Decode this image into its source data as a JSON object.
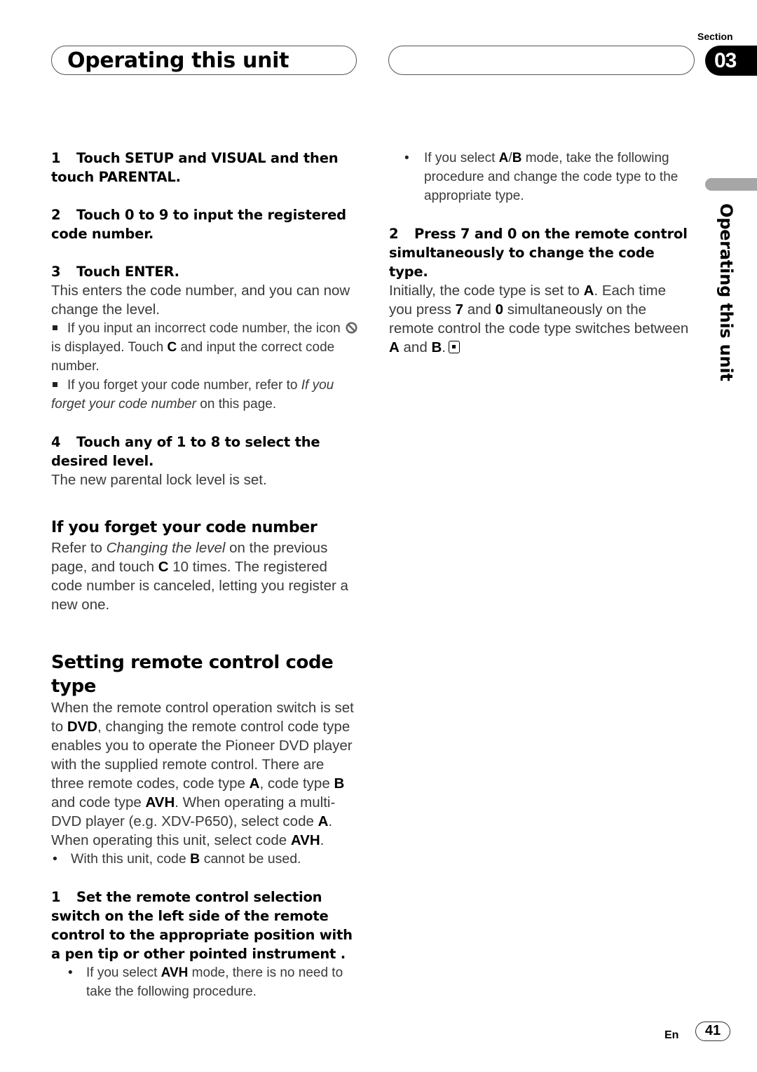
{
  "header": {
    "title": "Operating this unit",
    "section_label": "Section",
    "section_number": "03"
  },
  "side_tab": {
    "label": "Operating this unit"
  },
  "left_column": {
    "step1": {
      "num": "1",
      "text": "Touch SETUP and VISUAL and then touch PARENTAL."
    },
    "step2": {
      "num": "2",
      "text": "Touch 0 to 9 to input the registered code number."
    },
    "step3": {
      "num": "3",
      "text": "Touch ENTER."
    },
    "step3_body": "This enters the code number, and you can now change the level.",
    "note1": {
      "part1": "If you input an incorrect code number, the icon",
      "icon": "prohibited-icon",
      "part2": "is displayed. Touch",
      "key": "C",
      "part3": "and input the correct code number."
    },
    "note2": {
      "part1": "If you forget your code number, refer to",
      "italic": "If you forget your code number",
      "part2": "on this page."
    },
    "step4": {
      "num": "4",
      "text": "Touch any of 1 to 8 to select the desired level."
    },
    "step4_body": "The new parental lock level is set.",
    "forget_heading": "If you forget your code number",
    "forget_body": {
      "part1": "Refer to",
      "italic": "Changing the level",
      "part2": "on the previous page, and touch",
      "key": "C",
      "part3": "10 times. The registered code number is canceled, letting you register a new one."
    },
    "remote_heading": "Setting remote control code type",
    "remote_body": {
      "p1": "When the remote control operation switch is set to",
      "k1": "DVD",
      "p2": ", changing the remote control code type enables you to operate the Pioneer DVD player with the supplied remote control. There are three remote codes, code type",
      "k2": "A",
      "p3": ", code type",
      "k3": "B",
      "p4": "and code type",
      "k4": "AVH",
      "p5": ". When operating a multi-DVD player (e.g. XDV-P650), select code",
      "k5": "A",
      "p6": ". When operating this unit, select code",
      "k6": "AVH",
      "p7": "."
    },
    "remote_bullet": {
      "p1": "With this unit, code",
      "k1": "B",
      "p2": "cannot be used."
    },
    "rstep1": {
      "num": "1",
      "text": "Set the remote control selection switch on the left side of the remote control to the appropriate position with a pen tip or other pointed instrument ."
    },
    "rstep1_bullet": {
      "p1": "If you select",
      "k1": "AVH",
      "p2": "mode, there is no need to take the following procedure."
    }
  },
  "right_column": {
    "bullet": {
      "p1": "If you select",
      "k1": "A",
      "sep": "/",
      "k2": "B",
      "p2": "mode, take the following procedure and change the code type to the appropriate type."
    },
    "step2": {
      "num": "2",
      "text": "Press 7 and 0 on the remote control simultaneously to change the code type."
    },
    "step2_body": {
      "p1": "Initially, the code type is set to",
      "k1": "A",
      "p2": ". Each time you press",
      "k2": "7",
      "p3": "and",
      "k3": "0",
      "p4": "simultaneously on the remote control the code type switches between",
      "k4": "A",
      "p5": "and",
      "k5": "B",
      "p6": "."
    },
    "end_icon": "end-of-section-icon"
  },
  "footer": {
    "language": "En",
    "page_number": "41"
  }
}
